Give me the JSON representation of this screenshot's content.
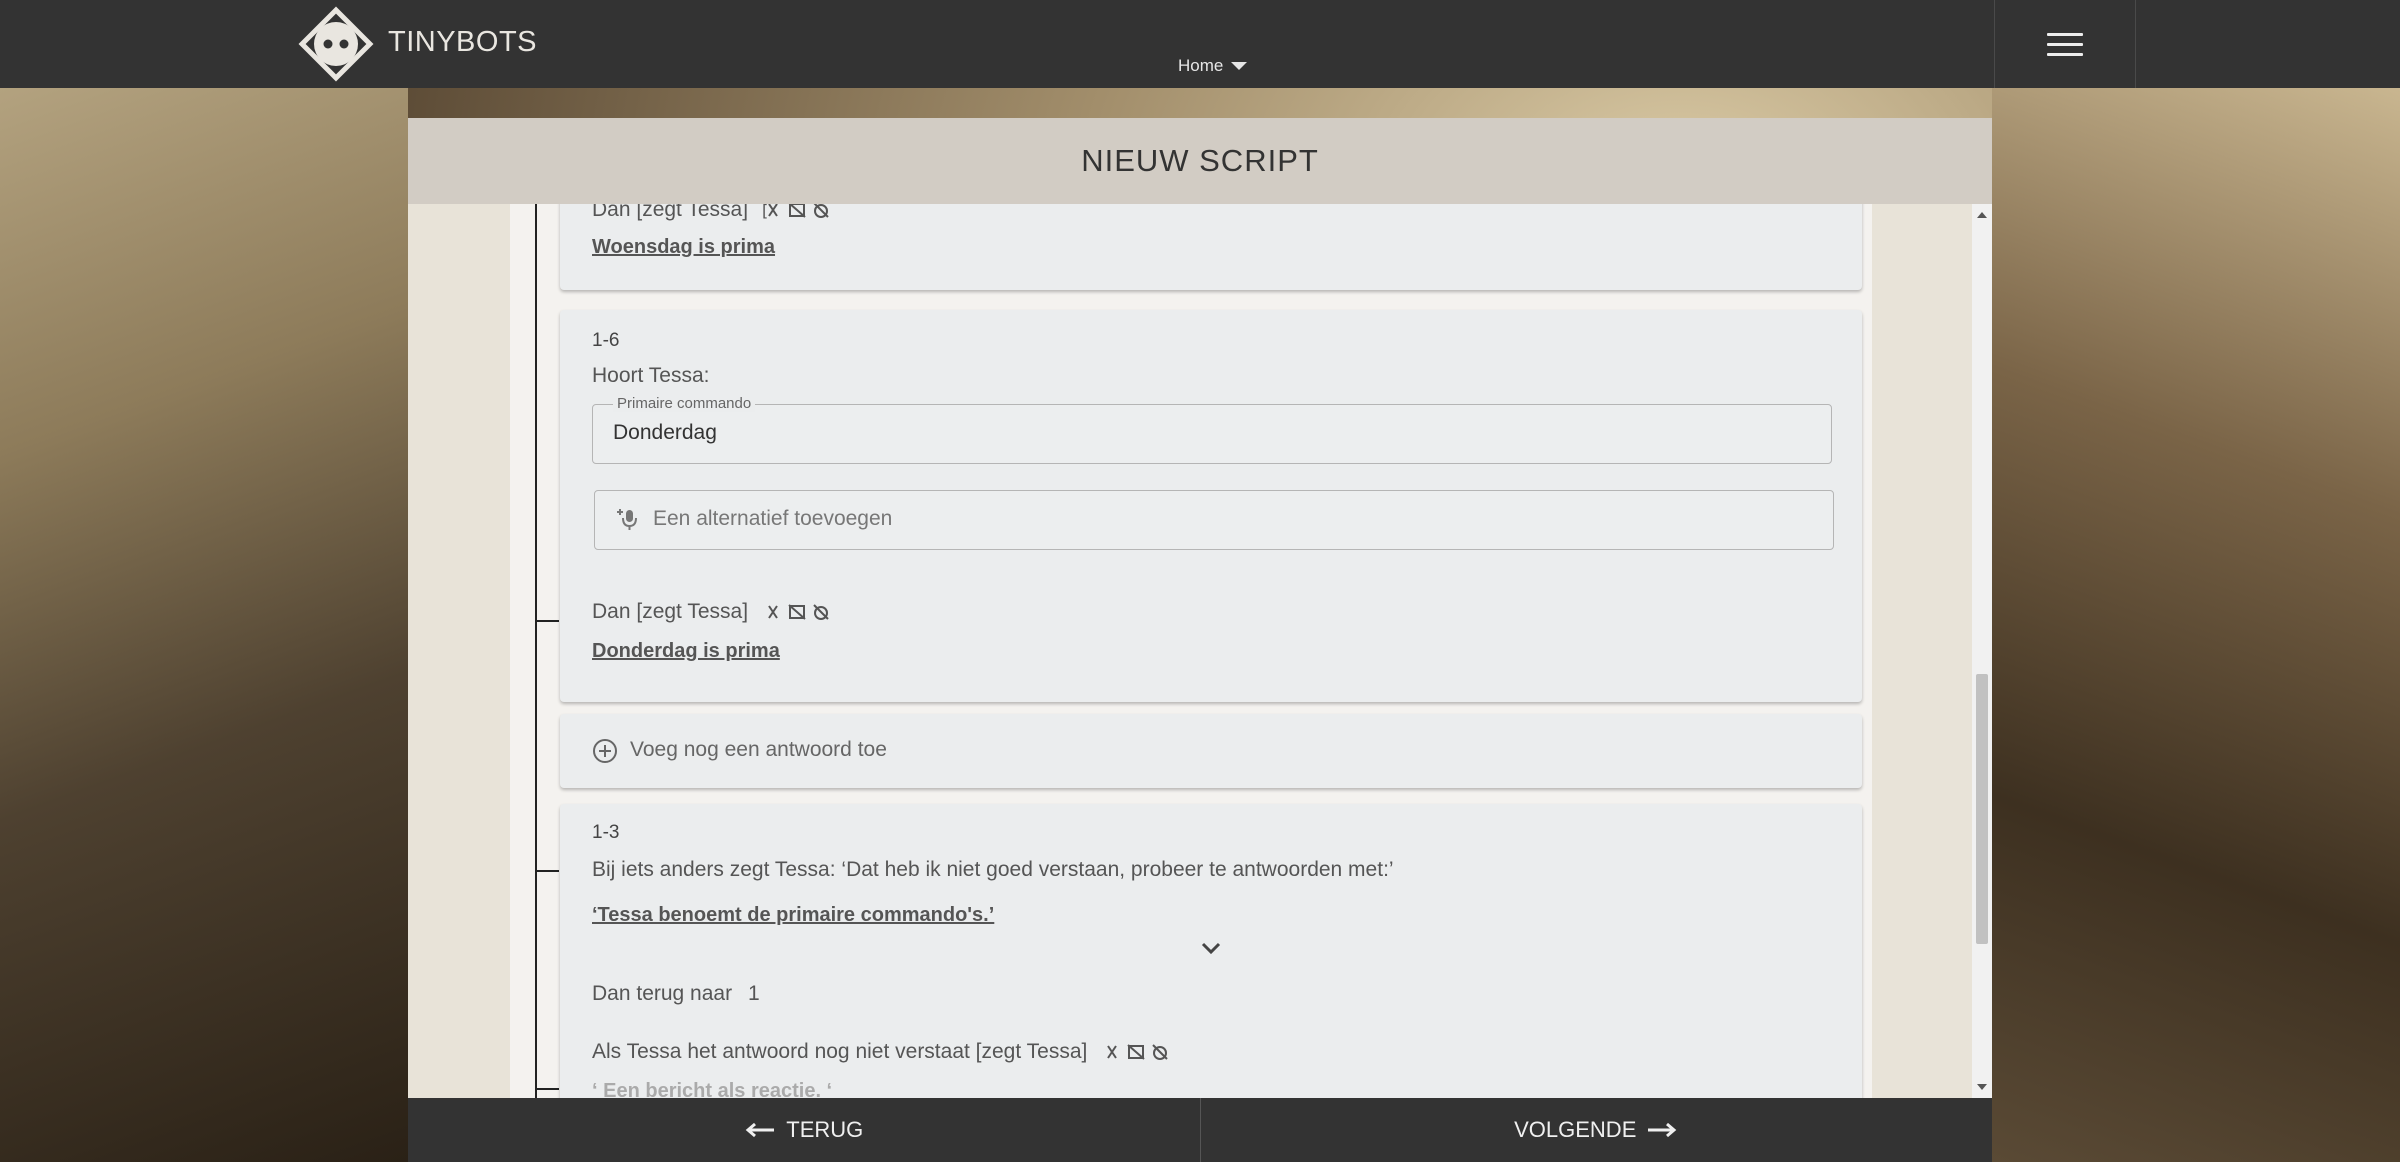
{
  "brand": {
    "name": "TINYBOTS"
  },
  "nav": {
    "home": "Home"
  },
  "page": {
    "title": "NIEUW SCRIPT"
  },
  "cards": {
    "top": {
      "says_prefix": "Dan [zegt Tessa]",
      "icon_open": "[",
      "icon_close": "]",
      "response": "Woensdag is prima"
    },
    "node16": {
      "id": "1-6",
      "hears": "Hoort Tessa:",
      "primary_label": "Primaire commando",
      "primary_value": "Donderdag",
      "alt_placeholder": "Een alternatief toevoegen",
      "says_prefix": "Dan [zegt Tessa]",
      "response": "Donderdag is prima"
    },
    "add_answer": {
      "label": "Voeg nog een antwoord toe"
    },
    "node13": {
      "id": "1-3",
      "fallback": "Bij iets anders zegt Tessa: ‘Dat heb ik niet goed verstaan, probeer te antwoorden met:’",
      "primary_cmds": "‘Tessa benoemt de primaire commando's.’",
      "goto_prefix": "Dan terug naar",
      "goto_target": "1",
      "not_understood": "Als Tessa het antwoord nog niet verstaat [zegt Tessa]",
      "reaction_placeholder": "‘ Een bericht als reactie. ‘"
    }
  },
  "footer": {
    "back": "TERUG",
    "next": "VOLGENDE"
  },
  "colors": {
    "topbar": "#333333",
    "header": "#d2ccc4",
    "card": "#ebedee"
  }
}
